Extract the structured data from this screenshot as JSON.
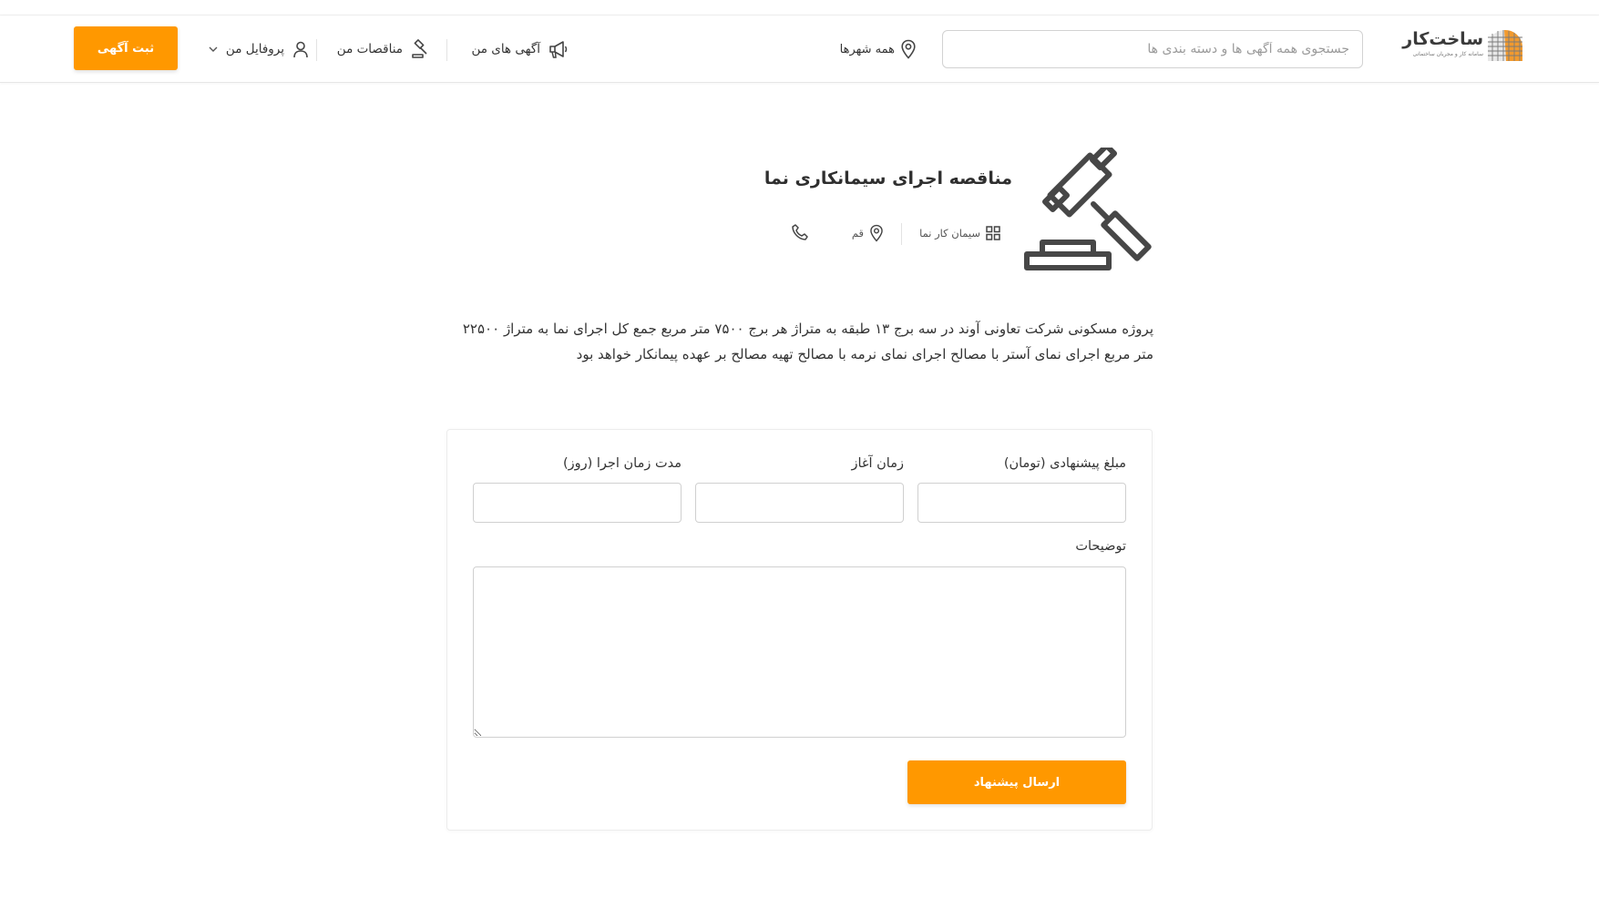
{
  "header": {
    "logo": {
      "title": "ساخت‌کار",
      "subtitle": "سامانه کار و مجریان ساختمانی"
    },
    "search": {
      "placeholder": "جستجوی همه آگهی ها و دسته بندی ها",
      "value": ""
    },
    "city_selector": {
      "label": "همه شهرها",
      "icon": "map-pin-icon"
    },
    "nav": {
      "my_ads": {
        "label": "آگهی های من",
        "icon": "megaphone-icon"
      },
      "my_tenders": {
        "label": "مناقصات من",
        "icon": "gavel-icon"
      },
      "profile": {
        "label": "پروفایل من",
        "icon": "user-icon",
        "caret": "chevron-down-icon"
      }
    },
    "post_ad_button": "ثبت آگهی"
  },
  "tender": {
    "title": "مناقصه اجرای سیمانکاری نما",
    "category": "سیمان کار نما",
    "city": "قم",
    "icons": {
      "hero": "gavel-icon",
      "category": "grid-icon",
      "city": "map-pin-icon",
      "phone": "phone-icon"
    },
    "description": "پروژه مسکونی شرکت تعاونی آوند در سه برج ۱۳ طبقه به متراژ هر برج ۷۵۰۰ متر مربع جمع کل اجرای نما به متراژ ۲۲۵۰۰ متر مربع اجرای نمای آستر با مصالح اجرای نمای نرمه با مصالح تهیه مصالح بر عهده پیمانکار خواهد بود"
  },
  "form": {
    "price_label": "مبلغ پیشنهادی (تومان)",
    "price_value": "",
    "start_label": "زمان آغاز",
    "start_value": "",
    "duration_label": "مدت زمان اجرا (روز)",
    "duration_value": "",
    "notes_label": "توضیحات",
    "notes_value": "",
    "submit_button": "ارسال پیشنهاد"
  },
  "colors": {
    "accent": "#ff9800",
    "text": "#333333",
    "border": "#d0d0d0"
  }
}
